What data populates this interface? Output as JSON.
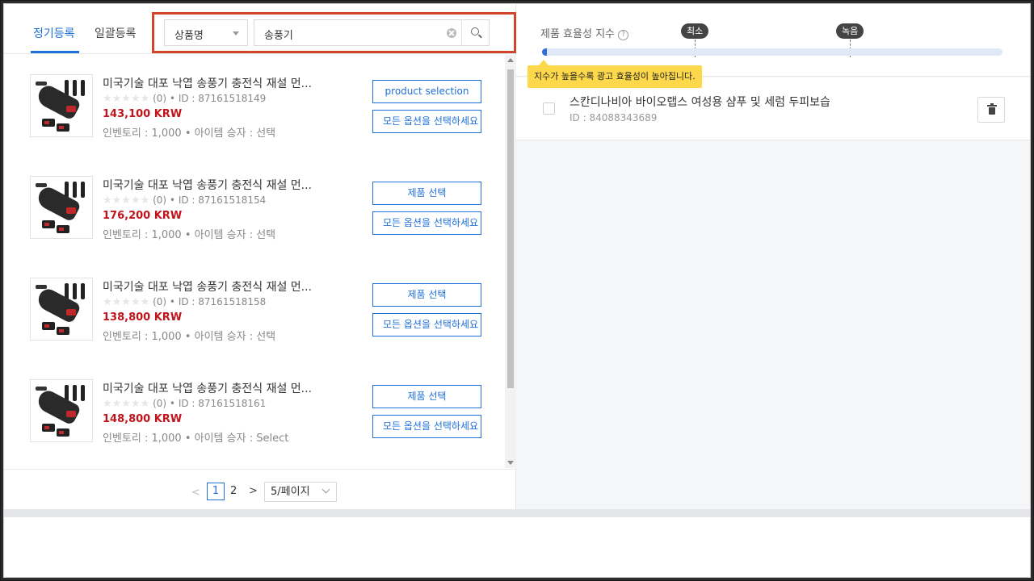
{
  "tabs": [
    {
      "label": "정기등록"
    },
    {
      "label": "일괄등록"
    }
  ],
  "search": {
    "field_select": "상품명",
    "query": "송풍기"
  },
  "products": [
    {
      "title": "미국기술 대포 낙엽 송풍기 충전식 재설 먼...",
      "rating_count": "(0)",
      "id_text": "ID : 87161518149",
      "price": "143,100 KRW",
      "inventory": "인벤토리 : 1,000 • 아이템 승자 : 선택",
      "select_label": "product selection",
      "all_options_label": "모든 옵션을 선택하세요"
    },
    {
      "title": "미국기술 대포 낙엽 송풍기 충전식 재설 먼...",
      "rating_count": "(0)",
      "id_text": "ID : 87161518154",
      "price": "176,200 KRW",
      "inventory": "인벤토리 : 1,000 • 아이템 승자 : 선택",
      "select_label": "제품 선택",
      "all_options_label": "모든 옵션을 선택하세요"
    },
    {
      "title": "미국기술 대포 낙엽 송풍기 충전식 재설 먼...",
      "rating_count": "(0)",
      "id_text": "ID : 87161518158",
      "price": "138,800 KRW",
      "inventory": "인벤토리 : 1,000 • 아이템 승자 : 선택",
      "select_label": "제품 선택",
      "all_options_label": "모든 옵션을 선택하세요"
    },
    {
      "title": "미국기술 대포 낙엽 송풍기 충전식 재설 먼...",
      "rating_count": "(0)",
      "id_text": "ID : 87161518161",
      "price": "148,800 KRW",
      "inventory": "인벤토리 : 1,000 • 아이템 승자 : Select",
      "select_label": "제품 선택",
      "all_options_label": "모든 옵션을 선택하세요"
    }
  ],
  "pagination": {
    "current": "1",
    "next_page": "2",
    "page_size": "5/페이지"
  },
  "efficiency": {
    "label": "제품 효율성 지수",
    "marker_min": "최소",
    "marker_green": "녹음",
    "tooltip": "지수가 높을수록 광고 효율성이 높아집니다.",
    "level_fraction": 0.01
  },
  "selected_product": {
    "title": "스칸디나비아 바이오랩스 여성용 샴푸 및 세럼 두피보습",
    "id_text": "ID : 84088343689"
  },
  "colors": {
    "accent": "#1e6fd9",
    "price": "#c0141b",
    "highlight": "#d1462b",
    "tooltip": "#fcd84a"
  }
}
